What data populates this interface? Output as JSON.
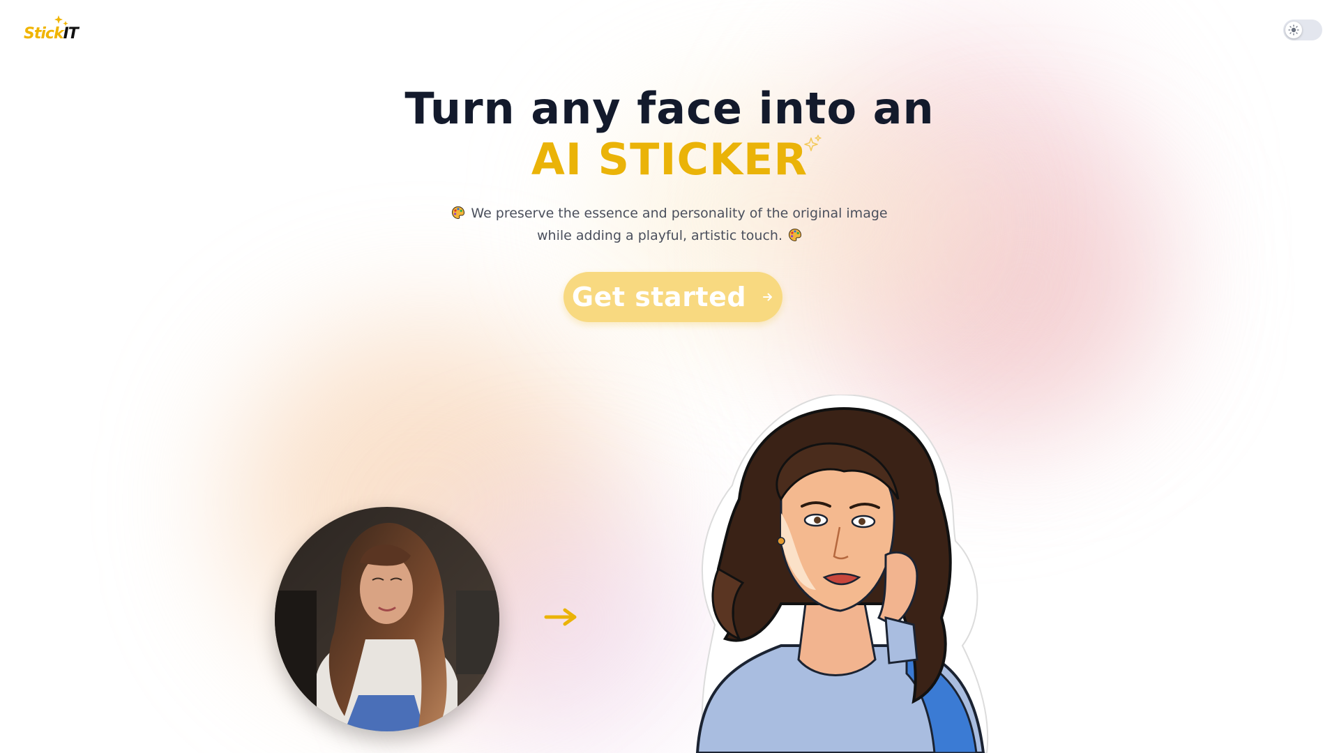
{
  "header": {
    "logo": {
      "text_main": "Stick",
      "text_accent": "IT",
      "icon": "sparkle-icon"
    },
    "theme_toggle": {
      "icon": "sun-icon",
      "state": "light"
    }
  },
  "hero": {
    "headline_line1": "Turn any face into an",
    "headline_line2": "AI STICKER",
    "headline_icon": "sparkle-icon",
    "subtext": "We preserve the essence and personality of the original image while adding a playful, artistic touch.",
    "subtext_icon": "artist-palette-icon",
    "cta_label": "Get started",
    "cta_icon": "arrow-right-icon"
  },
  "showcase": {
    "before_image": "portrait-photo",
    "transform_icon": "arrow-right-icon",
    "after_image": "sticker-illustration"
  },
  "colors": {
    "accent": "#eab308",
    "cta_background": "#f8d980",
    "headline": "#131a2c",
    "body_text": "#4a4f5c",
    "toggle_track": "#e3e6ee"
  }
}
